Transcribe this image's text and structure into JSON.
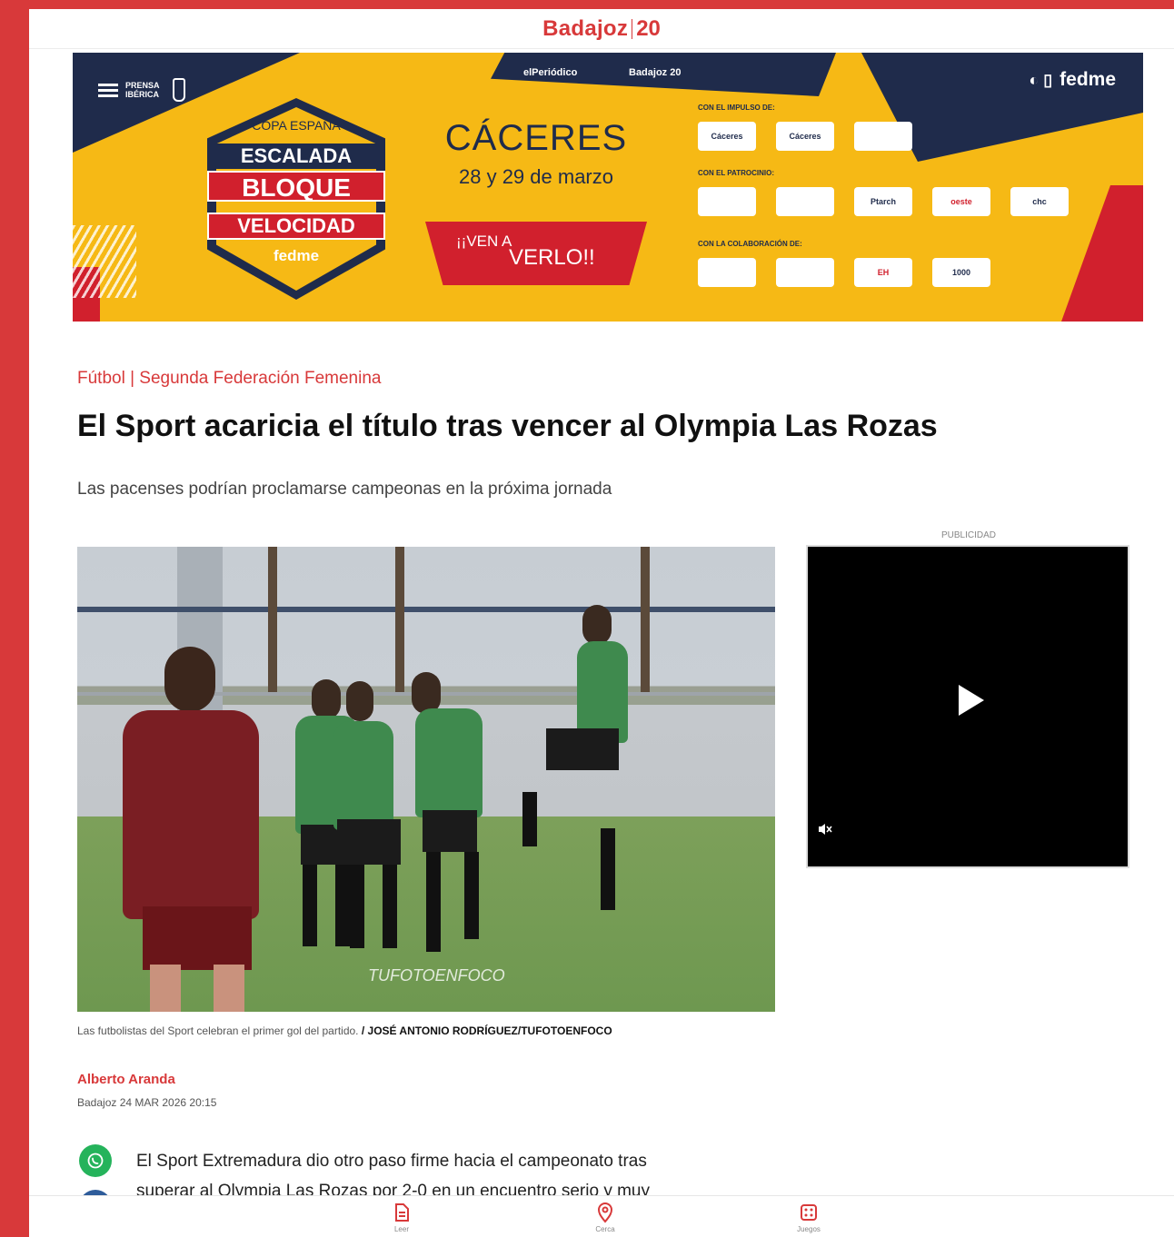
{
  "header": {
    "logo_name": "Badajoz",
    "logo_number": "20"
  },
  "banner": {
    "prensa": "PRENSA IBÉRICA",
    "top_left_brand": "elPeriódico",
    "top_mid_brand": "Badajoz 20",
    "badge_cap": "COPA ESPAÑA",
    "badge_line1": "ESCALADA",
    "badge_line2": "BLOQUE",
    "badge_line3": "VELOCIDAD",
    "badge_brand": "fedme",
    "city": "CÁCERES",
    "dates": "28 y 29 de marzo",
    "cta_line1": "¡¡VEN A",
    "cta_line2": "VERLO!!",
    "label_impulso": "CON EL IMPULSO DE:",
    "label_patrocinio": "CON EL PATROCINIO:",
    "label_colaboracion": "CON LA COLABORACIÓN DE:",
    "impulso_logos": [
      "Cáceres",
      "Cáceres",
      ""
    ],
    "patrocinio_logos": [
      "",
      "",
      "Ptarch",
      "oeste",
      "chc"
    ],
    "colaboracion_logos": [
      "",
      "",
      "EH",
      "1000"
    ],
    "right_brand": "fedme"
  },
  "article": {
    "category": "Fútbol | Segunda Federación Femenina",
    "headline": "El Sport acaricia el título tras vencer al Olympia Las Rozas",
    "subtitle": "Las pacenses podrían proclamarse campeonas en la próxima jornada",
    "photo_watermark": "TUFOTOENFOCO",
    "caption_text": "Las futbolistas del Sport celebran el primer gol del partido.",
    "caption_credit": "/ JOSÉ ANTONIO RODRÍGUEZ/TUFOTOENFOCO",
    "author": "Alberto Aranda",
    "dateline": "Badajoz 24 MAR 2026 20:15",
    "body_line1": "El Sport Extremadura dio otro paso firme hacia el campeonato tras",
    "body_line2": "superar al Olympia Las Rozas por 2-0 en un encuentro serio y muy"
  },
  "ad": {
    "label": "PUBLICIDAD"
  },
  "icons": {
    "whatsapp": "whatsapp-icon",
    "facebook": "facebook-icon",
    "play": "play-icon",
    "mute": "mute-icon",
    "nav_read": "document-icon",
    "nav_location": "location-pin-icon",
    "nav_games": "dice-icon"
  },
  "colors": {
    "brand_red": "#d8393a",
    "banner_yellow": "#f6b915",
    "banner_navy": "#1f2b4b",
    "whatsapp_green": "#25b35b"
  },
  "bottom_nav": {
    "items": [
      {
        "label": "Leer"
      },
      {
        "label": "Cerca"
      },
      {
        "label": "Juegos"
      }
    ]
  }
}
